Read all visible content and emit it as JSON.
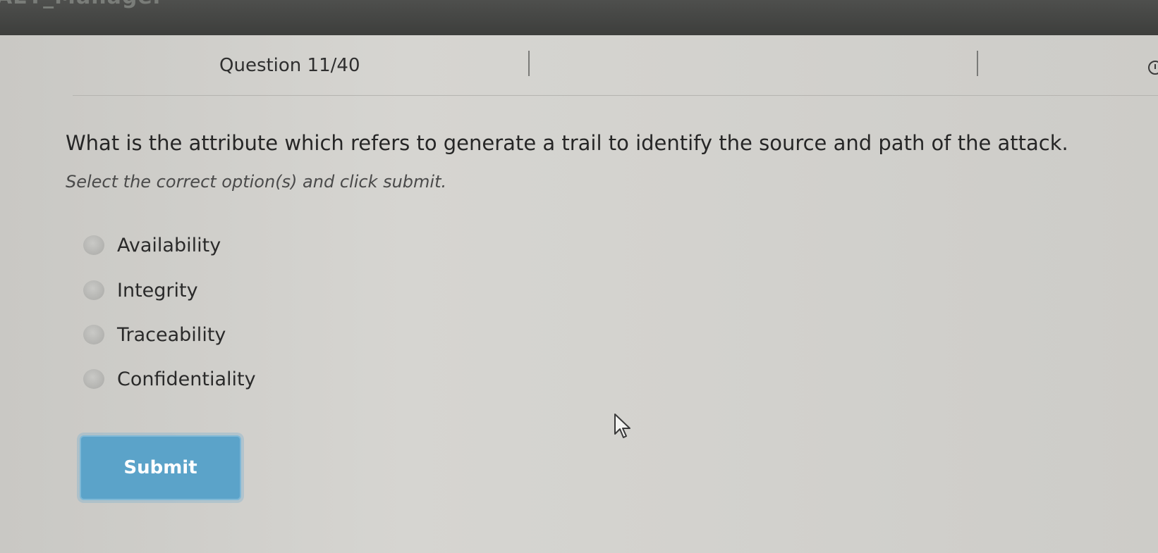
{
  "app": {
    "title": "AET_Manager"
  },
  "header": {
    "question_number": "Question 11/40"
  },
  "question": {
    "text": "What is the attribute which refers to generate a trail to identify the source and path of the attack.",
    "instruction": "Select the correct option(s) and click submit."
  },
  "options": [
    {
      "label": "Availability"
    },
    {
      "label": "Integrity"
    },
    {
      "label": "Traceability"
    },
    {
      "label": "Confidentiality"
    }
  ],
  "actions": {
    "submit_label": "Submit"
  },
  "icons": {
    "timer": "clock-icon",
    "cursor": "mouse-pointer-icon"
  },
  "colors": {
    "submit_button": "#5ba3c9",
    "panel": "#d3d2ce",
    "topbar": "#454644"
  }
}
